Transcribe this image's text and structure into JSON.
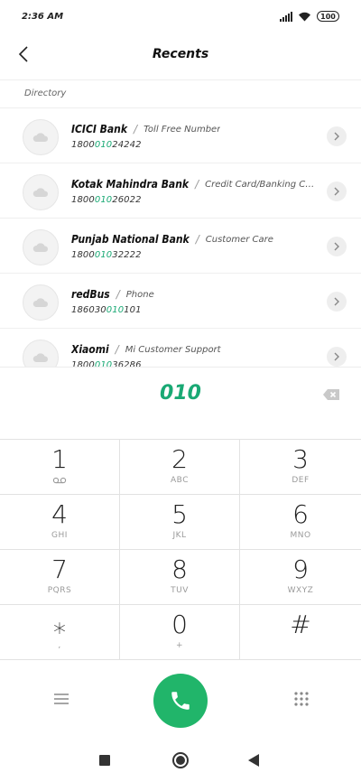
{
  "status_bar": {
    "time": "2:36 AM",
    "battery": "100",
    "icons": [
      "signal-icon",
      "wifi-icon",
      "battery-icon"
    ]
  },
  "header": {
    "title": "Recents",
    "back_icon": "chevron-left-icon"
  },
  "directory": {
    "label": "Directory",
    "items": [
      {
        "name": "ICICI Bank",
        "desc": "Toll Free Number",
        "number_pre": "1800",
        "number_hl": "010",
        "number_post": "24242"
      },
      {
        "name": "Kotak Mahindra Bank",
        "desc": "Credit Card/Banking Custo...",
        "number_pre": "1800",
        "number_hl": "010",
        "number_post": "26022"
      },
      {
        "name": "Punjab National Bank",
        "desc": "Customer Care",
        "number_pre": "1800",
        "number_hl": "010",
        "number_post": "32222"
      },
      {
        "name": "redBus",
        "desc": "Phone",
        "number_pre": "186030",
        "number_hl": "010",
        "number_post": "101"
      },
      {
        "name": "Xiaomi",
        "desc": "Mi Customer Support",
        "number_pre": "1800",
        "number_hl": "010",
        "number_post": "36286"
      }
    ]
  },
  "dialer": {
    "entered": "010",
    "keys": [
      {
        "digit": "1",
        "letters": ""
      },
      {
        "digit": "2",
        "letters": "ABC"
      },
      {
        "digit": "3",
        "letters": "DEF"
      },
      {
        "digit": "4",
        "letters": "GHI"
      },
      {
        "digit": "5",
        "letters": "JKL"
      },
      {
        "digit": "6",
        "letters": "MNO"
      },
      {
        "digit": "7",
        "letters": "PQRS"
      },
      {
        "digit": "8",
        "letters": "TUV"
      },
      {
        "digit": "9",
        "letters": "WXYZ"
      },
      {
        "digit": "⁎",
        "letters": ","
      },
      {
        "digit": "0",
        "letters": "+"
      },
      {
        "digit": "#",
        "letters": ""
      }
    ]
  },
  "colors": {
    "accent": "#19a974",
    "call_button": "#21b56a"
  }
}
